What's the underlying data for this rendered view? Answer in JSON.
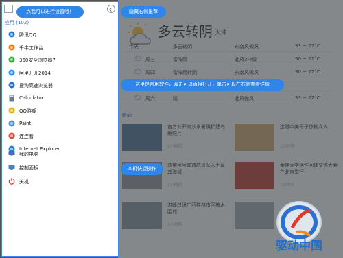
{
  "menu": {
    "apps_header": "应用 (102)",
    "apps": [
      {
        "label": "腾讯QQ",
        "icon": "qq-penguin-icon",
        "color": "#2a77d3"
      },
      {
        "label": "千牛工作台",
        "icon": "qianniu-icon",
        "color": "#f07a12"
      },
      {
        "label": "360安全浏览器7",
        "icon": "browser-360-icon",
        "color": "#38a537"
      },
      {
        "label": "阿里旺旺2014",
        "icon": "aliwangwang-icon",
        "color": "#1e90ff"
      },
      {
        "label": "搜狗高速浏览器",
        "icon": "sogou-browser-icon",
        "color": "#2b6cc4"
      },
      {
        "label": "Calculator",
        "icon": "calculator-icon",
        "color": "#6b7a8a"
      },
      {
        "label": "QQ游戏",
        "icon": "qq-game-icon",
        "color": "#e9b21c"
      },
      {
        "label": "Paint",
        "icon": "paint-icon",
        "color": "#4a90d9"
      },
      {
        "label": "连连看",
        "icon": "lianliankan-icon",
        "color": "#d84b3c"
      },
      {
        "label": "Internet Explorer",
        "icon": "internet-explorer-icon",
        "color": "#1f7fd6"
      }
    ],
    "system": [
      {
        "label": "我的电脑",
        "icon": "computer-icon",
        "color": "#3b6fb6"
      },
      {
        "label": "控制面板",
        "icon": "control-panel-icon",
        "color": "#4a7fc1"
      },
      {
        "label": "关机",
        "icon": "power-icon",
        "color": "#d9352a"
      }
    ]
  },
  "tooltips": {
    "settings": "点我可以进行设置哦！",
    "hide_recommend": "隐藏右侧推荐",
    "common_software": "这里是常用软件，双击可以直接打开，单击可以在右侧查看详情",
    "shortcuts": "本机快捷操作"
  },
  "weather": {
    "condition": "多云转阴",
    "city": "天津",
    "forecast": [
      {
        "day": "今天",
        "desc": "多云转阴",
        "wind": "东南风微风",
        "temp": "33 ~ 27°C"
      },
      {
        "day": "周三",
        "desc": "雷阵雨",
        "wind": "北风3-4级",
        "temp": "30 ~ 21°C"
      },
      {
        "day": "周四",
        "desc": "雷阵雨转阴",
        "wind": "东南风微风",
        "temp": "30 ~ 22°C"
      },
      {
        "day": "周五",
        "desc": "",
        "wind": "",
        "temp": ""
      },
      {
        "day": "周六",
        "desc": "晴",
        "wind": "北风微风",
        "temp": "33 ~ 22°C"
      }
    ]
  },
  "news": {
    "label": "新闻",
    "items": [
      {
        "title": "官方公开南沙永暑礁扩建岛礁照片",
        "time": "1小时前",
        "thumb": "#4a6f8f"
      },
      {
        "title": "这碰中美母子惊艳众人",
        "time": "1小时前",
        "thumb": "#c9a36a"
      },
      {
        "title": "救俄民阿联酋航班坠入土耳其海域",
        "time": "1小时前",
        "thumb": "#8c8f96"
      },
      {
        "title": "柔佛大学活性回体交流大会在北京举行",
        "time": "1小时前",
        "thumb": "#b33a2e"
      },
      {
        "title": "洪峰过境广西桂林市区被水围城",
        "time": "1小时前",
        "thumb": "#7d8e99"
      },
      {
        "title": "",
        "time": "",
        "thumb": "#9aa6ad"
      }
    ]
  },
  "watermark": {
    "text": "驱动中国",
    "color": "#1f6fd1"
  }
}
